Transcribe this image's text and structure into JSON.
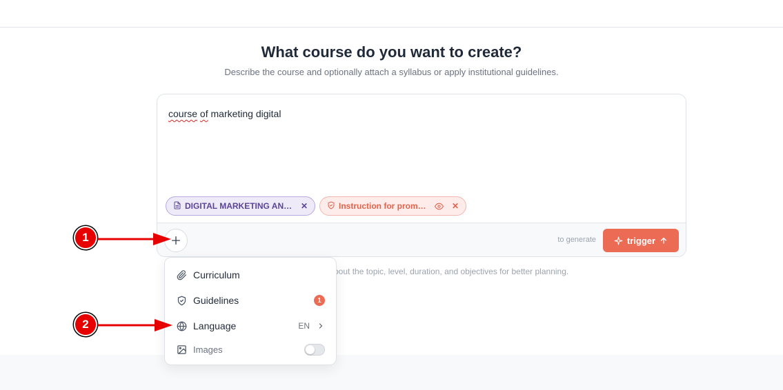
{
  "header": {
    "title": "What course do you want to create?",
    "subtitle": "Describe the course and optionally attach a syllabus or apply institutional guidelines."
  },
  "composer": {
    "prompt": {
      "word1": "course",
      "word2": "of",
      "rest": "marketing digital"
    },
    "attachments": [
      {
        "label": "DIGITAL MARKETING AN…",
        "icon": "file-icon",
        "close": "✕"
      },
      {
        "label": "Instruction for prompts",
        "icon": "shield-check-icon",
        "close": "✕"
      }
    ],
    "hint": "to generate",
    "trigger_label": "trigger"
  },
  "helper_text": "bout the topic, level, duration, and objectives for better planning.",
  "menu": {
    "items": [
      {
        "label": "Curriculum",
        "icon": "paperclip-icon"
      },
      {
        "label": "Guidelines",
        "icon": "shield-check-icon",
        "badge": "1"
      },
      {
        "label": "Language",
        "icon": "globe-icon",
        "value": "EN"
      },
      {
        "label": "Images",
        "icon": "image-icon",
        "enabled": false
      }
    ]
  },
  "annotations": {
    "first": "1",
    "second": "2",
    "color": "#e60000"
  },
  "colors": {
    "accent": "#ec6b55",
    "doc_chip": "#5b4596",
    "guide_chip": "#e0634b"
  }
}
